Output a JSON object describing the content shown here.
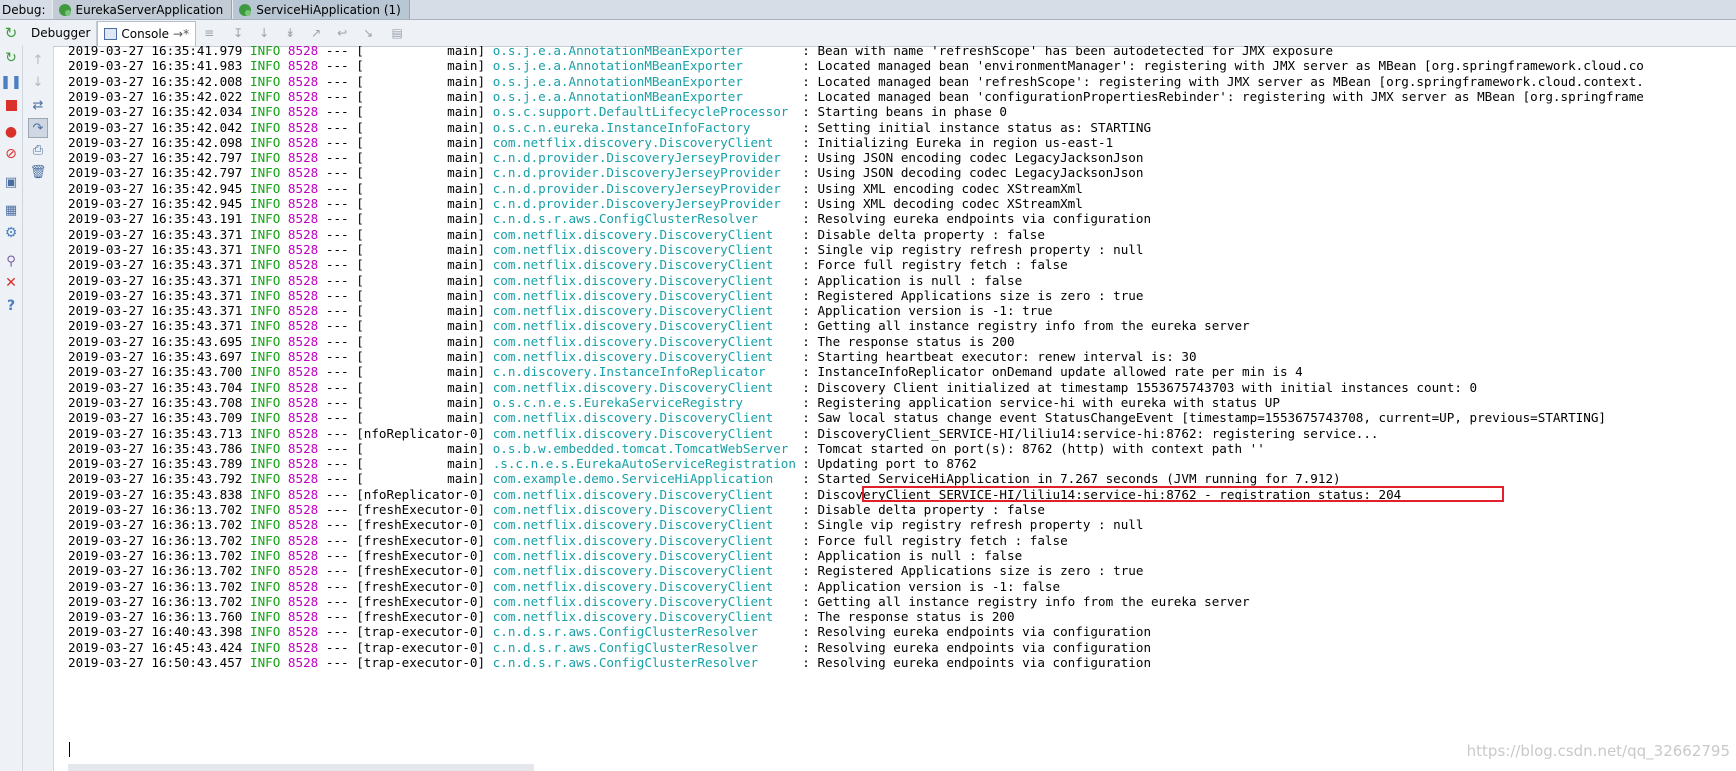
{
  "topbar": {
    "label": "Debug:",
    "tabs": [
      {
        "label": "EurekaServerApplication"
      },
      {
        "label": "ServiceHiApplication (1)"
      }
    ]
  },
  "subbar": {
    "tabs": [
      {
        "label": "Debugger"
      },
      {
        "label": "Console"
      }
    ],
    "console_arrow": "→*"
  },
  "colors": {
    "level": "#12a312",
    "pid": "#c000c0",
    "logger": "#18a0a8",
    "highlight": "#e0202a"
  },
  "log": {
    "lines": [
      {
        "ts": "2019-03-27 16:35:41.979",
        "level": "INFO",
        "pid": "8528",
        "thread": "--- [           main]",
        "logger": "o.s.j.e.a.AnnotationMBeanExporter",
        "msg": ": Bean with name 'refreshScope' has been autodetected for JMX exposure"
      },
      {
        "ts": "2019-03-27 16:35:41.983",
        "level": "INFO",
        "pid": "8528",
        "thread": "--- [           main]",
        "logger": "o.s.j.e.a.AnnotationMBeanExporter",
        "msg": ": Located managed bean 'environmentManager': registering with JMX server as MBean [org.springframework.cloud.co"
      },
      {
        "ts": "2019-03-27 16:35:42.008",
        "level": "INFO",
        "pid": "8528",
        "thread": "--- [           main]",
        "logger": "o.s.j.e.a.AnnotationMBeanExporter",
        "msg": ": Located managed bean 'refreshScope': registering with JMX server as MBean [org.springframework.cloud.context."
      },
      {
        "ts": "2019-03-27 16:35:42.022",
        "level": "INFO",
        "pid": "8528",
        "thread": "--- [           main]",
        "logger": "o.s.j.e.a.AnnotationMBeanExporter",
        "msg": ": Located managed bean 'configurationPropertiesRebinder': registering with JMX server as MBean [org.springframe"
      },
      {
        "ts": "2019-03-27 16:35:42.034",
        "level": "INFO",
        "pid": "8528",
        "thread": "--- [           main]",
        "logger": "o.s.c.support.DefaultLifecycleProcessor",
        "msg": ": Starting beans in phase 0"
      },
      {
        "ts": "2019-03-27 16:35:42.042",
        "level": "INFO",
        "pid": "8528",
        "thread": "--- [           main]",
        "logger": "o.s.c.n.eureka.InstanceInfoFactory",
        "msg": ": Setting initial instance status as: STARTING"
      },
      {
        "ts": "2019-03-27 16:35:42.098",
        "level": "INFO",
        "pid": "8528",
        "thread": "--- [           main]",
        "logger": "com.netflix.discovery.DiscoveryClient",
        "msg": ": Initializing Eureka in region us-east-1"
      },
      {
        "ts": "2019-03-27 16:35:42.797",
        "level": "INFO",
        "pid": "8528",
        "thread": "--- [           main]",
        "logger": "c.n.d.provider.DiscoveryJerseyProvider",
        "msg": ": Using JSON encoding codec LegacyJacksonJson"
      },
      {
        "ts": "2019-03-27 16:35:42.797",
        "level": "INFO",
        "pid": "8528",
        "thread": "--- [           main]",
        "logger": "c.n.d.provider.DiscoveryJerseyProvider",
        "msg": ": Using JSON decoding codec LegacyJacksonJson"
      },
      {
        "ts": "2019-03-27 16:35:42.945",
        "level": "INFO",
        "pid": "8528",
        "thread": "--- [           main]",
        "logger": "c.n.d.provider.DiscoveryJerseyProvider",
        "msg": ": Using XML encoding codec XStreamXml"
      },
      {
        "ts": "2019-03-27 16:35:42.945",
        "level": "INFO",
        "pid": "8528",
        "thread": "--- [           main]",
        "logger": "c.n.d.provider.DiscoveryJerseyProvider",
        "msg": ": Using XML decoding codec XStreamXml"
      },
      {
        "ts": "2019-03-27 16:35:43.191",
        "level": "INFO",
        "pid": "8528",
        "thread": "--- [           main]",
        "logger": "c.n.d.s.r.aws.ConfigClusterResolver",
        "msg": ": Resolving eureka endpoints via configuration"
      },
      {
        "ts": "2019-03-27 16:35:43.371",
        "level": "INFO",
        "pid": "8528",
        "thread": "--- [           main]",
        "logger": "com.netflix.discovery.DiscoveryClient",
        "msg": ": Disable delta property : false"
      },
      {
        "ts": "2019-03-27 16:35:43.371",
        "level": "INFO",
        "pid": "8528",
        "thread": "--- [           main]",
        "logger": "com.netflix.discovery.DiscoveryClient",
        "msg": ": Single vip registry refresh property : null"
      },
      {
        "ts": "2019-03-27 16:35:43.371",
        "level": "INFO",
        "pid": "8528",
        "thread": "--- [           main]",
        "logger": "com.netflix.discovery.DiscoveryClient",
        "msg": ": Force full registry fetch : false"
      },
      {
        "ts": "2019-03-27 16:35:43.371",
        "level": "INFO",
        "pid": "8528",
        "thread": "--- [           main]",
        "logger": "com.netflix.discovery.DiscoveryClient",
        "msg": ": Application is null : false"
      },
      {
        "ts": "2019-03-27 16:35:43.371",
        "level": "INFO",
        "pid": "8528",
        "thread": "--- [           main]",
        "logger": "com.netflix.discovery.DiscoveryClient",
        "msg": ": Registered Applications size is zero : true"
      },
      {
        "ts": "2019-03-27 16:35:43.371",
        "level": "INFO",
        "pid": "8528",
        "thread": "--- [           main]",
        "logger": "com.netflix.discovery.DiscoveryClient",
        "msg": ": Application version is -1: true"
      },
      {
        "ts": "2019-03-27 16:35:43.371",
        "level": "INFO",
        "pid": "8528",
        "thread": "--- [           main]",
        "logger": "com.netflix.discovery.DiscoveryClient",
        "msg": ": Getting all instance registry info from the eureka server"
      },
      {
        "ts": "2019-03-27 16:35:43.695",
        "level": "INFO",
        "pid": "8528",
        "thread": "--- [           main]",
        "logger": "com.netflix.discovery.DiscoveryClient",
        "msg": ": The response status is 200"
      },
      {
        "ts": "2019-03-27 16:35:43.697",
        "level": "INFO",
        "pid": "8528",
        "thread": "--- [           main]",
        "logger": "com.netflix.discovery.DiscoveryClient",
        "msg": ": Starting heartbeat executor: renew interval is: 30"
      },
      {
        "ts": "2019-03-27 16:35:43.700",
        "level": "INFO",
        "pid": "8528",
        "thread": "--- [           main]",
        "logger": "c.n.discovery.InstanceInfoReplicator",
        "msg": ": InstanceInfoReplicator onDemand update allowed rate per min is 4"
      },
      {
        "ts": "2019-03-27 16:35:43.704",
        "level": "INFO",
        "pid": "8528",
        "thread": "--- [           main]",
        "logger": "com.netflix.discovery.DiscoveryClient",
        "msg": ": Discovery Client initialized at timestamp 1553675743703 with initial instances count: 0"
      },
      {
        "ts": "2019-03-27 16:35:43.708",
        "level": "INFO",
        "pid": "8528",
        "thread": "--- [           main]",
        "logger": "o.s.c.n.e.s.EurekaServiceRegistry",
        "msg": ": Registering application service-hi with eureka with status UP"
      },
      {
        "ts": "2019-03-27 16:35:43.709",
        "level": "INFO",
        "pid": "8528",
        "thread": "--- [           main]",
        "logger": "com.netflix.discovery.DiscoveryClient",
        "msg": ": Saw local status change event StatusChangeEvent [timestamp=1553675743708, current=UP, previous=STARTING]"
      },
      {
        "ts": "2019-03-27 16:35:43.713",
        "level": "INFO",
        "pid": "8528",
        "thread": "--- [nfoReplicator-0]",
        "logger": "com.netflix.discovery.DiscoveryClient",
        "msg": ": DiscoveryClient_SERVICE-HI/liliu14:service-hi:8762: registering service..."
      },
      {
        "ts": "2019-03-27 16:35:43.786",
        "level": "INFO",
        "pid": "8528",
        "thread": "--- [           main]",
        "logger": "o.s.b.w.embedded.tomcat.TomcatWebServer",
        "msg": ": Tomcat started on port(s): 8762 (http) with context path ''"
      },
      {
        "ts": "2019-03-27 16:35:43.789",
        "level": "INFO",
        "pid": "8528",
        "thread": "--- [           main]",
        "logger": ".s.c.n.e.s.EurekaAutoServiceRegistration",
        "msg": ": Updating port to 8762"
      },
      {
        "ts": "2019-03-27 16:35:43.792",
        "level": "INFO",
        "pid": "8528",
        "thread": "--- [           main]",
        "logger": "com.example.demo.ServiceHiApplication",
        "msg": ": Started ServiceHiApplication in 7.267 seconds (JVM running for 7.912)"
      },
      {
        "ts": "2019-03-27 16:35:43.838",
        "level": "INFO",
        "pid": "8528",
        "thread": "--- [nfoReplicator-0]",
        "logger": "com.netflix.discovery.DiscoveryClient",
        "msg": ": DiscoveryClient_SERVICE-HI/liliu14:service-hi:8762 - registration status: 204"
      },
      {
        "ts": "2019-03-27 16:36:13.702",
        "level": "INFO",
        "pid": "8528",
        "thread": "--- [freshExecutor-0]",
        "logger": "com.netflix.discovery.DiscoveryClient",
        "msg": ": Disable delta property : false"
      },
      {
        "ts": "2019-03-27 16:36:13.702",
        "level": "INFO",
        "pid": "8528",
        "thread": "--- [freshExecutor-0]",
        "logger": "com.netflix.discovery.DiscoveryClient",
        "msg": ": Single vip registry refresh property : null"
      },
      {
        "ts": "2019-03-27 16:36:13.702",
        "level": "INFO",
        "pid": "8528",
        "thread": "--- [freshExecutor-0]",
        "logger": "com.netflix.discovery.DiscoveryClient",
        "msg": ": Force full registry fetch : false"
      },
      {
        "ts": "2019-03-27 16:36:13.702",
        "level": "INFO",
        "pid": "8528",
        "thread": "--- [freshExecutor-0]",
        "logger": "com.netflix.discovery.DiscoveryClient",
        "msg": ": Application is null : false"
      },
      {
        "ts": "2019-03-27 16:36:13.702",
        "level": "INFO",
        "pid": "8528",
        "thread": "--- [freshExecutor-0]",
        "logger": "com.netflix.discovery.DiscoveryClient",
        "msg": ": Registered Applications size is zero : true"
      },
      {
        "ts": "2019-03-27 16:36:13.702",
        "level": "INFO",
        "pid": "8528",
        "thread": "--- [freshExecutor-0]",
        "logger": "com.netflix.discovery.DiscoveryClient",
        "msg": ": Application version is -1: false"
      },
      {
        "ts": "2019-03-27 16:36:13.702",
        "level": "INFO",
        "pid": "8528",
        "thread": "--- [freshExecutor-0]",
        "logger": "com.netflix.discovery.DiscoveryClient",
        "msg": ": Getting all instance registry info from the eureka server"
      },
      {
        "ts": "2019-03-27 16:36:13.760",
        "level": "INFO",
        "pid": "8528",
        "thread": "--- [freshExecutor-0]",
        "logger": "com.netflix.discovery.DiscoveryClient",
        "msg": ": The response status is 200"
      },
      {
        "ts": "2019-03-27 16:40:43.398",
        "level": "INFO",
        "pid": "8528",
        "thread": "--- [trap-executor-0]",
        "logger": "c.n.d.s.r.aws.ConfigClusterResolver",
        "msg": ": Resolving eureka endpoints via configuration"
      },
      {
        "ts": "2019-03-27 16:45:43.424",
        "level": "INFO",
        "pid": "8528",
        "thread": "--- [trap-executor-0]",
        "logger": "c.n.d.s.r.aws.ConfigClusterResolver",
        "msg": ": Resolving eureka endpoints via configuration"
      },
      {
        "ts": "2019-03-27 16:50:43.457",
        "level": "INFO",
        "pid": "8528",
        "thread": "--- [trap-executor-0]",
        "logger": "c.n.d.s.r.aws.ConfigClusterResolver",
        "msg": ": Resolving eureka endpoints via configuration"
      }
    ],
    "highlighted_line": 29
  },
  "watermark": "https://blog.csdn.net/qq_32662795"
}
